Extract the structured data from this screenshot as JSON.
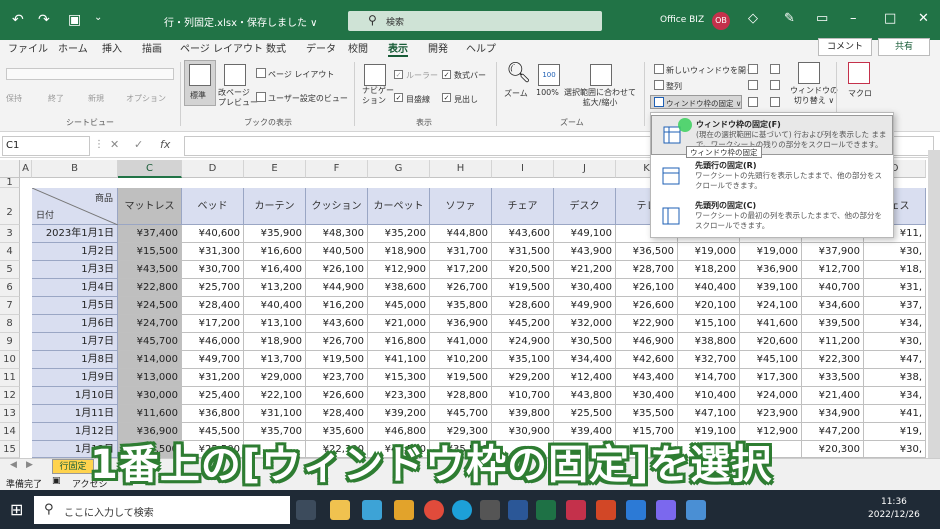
{
  "titlebar": {
    "filename": "行・列固定.xlsx・保存しました ∨",
    "search_icon": "search-icon",
    "search_placeholder": "検索",
    "account": "Office BIZ",
    "avatar": "OB"
  },
  "tabs": [
    "ファイル",
    "ホーム",
    "挿入",
    "描画",
    "ページ レイアウト",
    "数式",
    "データ",
    "校閲",
    "表示",
    "開発",
    "ヘルプ"
  ],
  "active_tab": "表示",
  "comment_btn": "コメント",
  "share_btn": "共有",
  "ribbon": {
    "sheetview": {
      "buttons": [
        "保持",
        "終了",
        "新規",
        "オプション"
      ],
      "label": "シートビュー"
    },
    "bookview": {
      "normal": "標準",
      "pagebreak": "改ページ\nプレビュー",
      "pagelayout": "ページ レイアウト",
      "userview": "ユーザー設定のビュー",
      "label": "ブックの表示"
    },
    "show": {
      "nav": "ナビゲー\nション",
      "ruler": "ルーラー",
      "formulabar": "数式バー",
      "gridlines": "目盛線",
      "headings": "見出し",
      "label": "表示"
    },
    "zoom": {
      "zoom": "ズーム",
      "z100": "100%",
      "tosel": "選択範囲に合わせて\n拡大/縮小",
      "label": "ズーム"
    },
    "window": {
      "newwin": "新しいウィンドウを開く",
      "arrange": "整列",
      "freeze": "ウィンドウ枠の固定 ∨",
      "switch": "ウィンドウの\n切り替え ∨"
    },
    "macro": {
      "label": "マクロ"
    }
  },
  "formulabar": {
    "namebox": "C1"
  },
  "columns": [
    "A",
    "B",
    "C",
    "D",
    "E",
    "F",
    "G",
    "H",
    "I",
    "J",
    "K",
    "L",
    "M",
    "N",
    "O"
  ],
  "rows": [
    "1",
    "2",
    "3",
    "4",
    "5",
    "6",
    "7",
    "8",
    "9",
    "10",
    "11",
    "12",
    "13",
    "14",
    "15"
  ],
  "header": {
    "corner_top": "商品",
    "corner_bottom": "日付",
    "products": [
      "マットレス",
      "ベッド",
      "カーテン",
      "クッション",
      "カーペット",
      "ソファ",
      "チェア",
      "デスク",
      "テレ",
      "",
      "",
      "",
      "チェス"
    ]
  },
  "data": [
    {
      "date": "2023年1月1日",
      "vals": [
        "¥37,400",
        "¥40,600",
        "¥35,900",
        "¥48,300",
        "¥35,200",
        "¥44,800",
        "¥43,600",
        "¥49,100",
        "",
        "",
        "",
        "",
        "¥11,"
      ]
    },
    {
      "date": "1月2日",
      "vals": [
        "¥15,500",
        "¥31,300",
        "¥16,600",
        "¥40,500",
        "¥18,900",
        "¥31,700",
        "¥31,500",
        "¥43,900",
        "¥36,500",
        "¥19,000",
        "¥19,000",
        "¥37,900",
        "¥30,"
      ]
    },
    {
      "date": "1月3日",
      "vals": [
        "¥43,500",
        "¥30,700",
        "¥16,400",
        "¥26,100",
        "¥12,900",
        "¥17,200",
        "¥20,500",
        "¥21,200",
        "¥28,700",
        "¥18,200",
        "¥36,900",
        "¥12,700",
        "¥18,"
      ]
    },
    {
      "date": "1月4日",
      "vals": [
        "¥22,800",
        "¥25,700",
        "¥13,200",
        "¥44,900",
        "¥38,600",
        "¥26,700",
        "¥19,500",
        "¥30,400",
        "¥26,100",
        "¥40,400",
        "¥39,100",
        "¥40,700",
        "¥31,"
      ]
    },
    {
      "date": "1月5日",
      "vals": [
        "¥24,500",
        "¥28,400",
        "¥40,400",
        "¥16,200",
        "¥45,000",
        "¥35,800",
        "¥28,600",
        "¥49,900",
        "¥26,600",
        "¥20,100",
        "¥24,100",
        "¥34,600",
        "¥37,"
      ]
    },
    {
      "date": "1月6日",
      "vals": [
        "¥24,700",
        "¥17,200",
        "¥13,100",
        "¥43,600",
        "¥21,000",
        "¥36,900",
        "¥45,200",
        "¥32,000",
        "¥22,900",
        "¥15,100",
        "¥41,600",
        "¥39,500",
        "¥34,"
      ]
    },
    {
      "date": "1月7日",
      "vals": [
        "¥45,700",
        "¥46,000",
        "¥18,900",
        "¥26,700",
        "¥16,800",
        "¥41,000",
        "¥24,900",
        "¥30,500",
        "¥46,900",
        "¥38,800",
        "¥20,600",
        "¥11,200",
        "¥30,"
      ]
    },
    {
      "date": "1月8日",
      "vals": [
        "¥14,000",
        "¥49,700",
        "¥13,700",
        "¥19,500",
        "¥41,100",
        "¥10,200",
        "¥35,100",
        "¥34,400",
        "¥42,600",
        "¥32,700",
        "¥45,100",
        "¥22,300",
        "¥47,"
      ]
    },
    {
      "date": "1月9日",
      "vals": [
        "¥13,000",
        "¥31,200",
        "¥29,000",
        "¥23,700",
        "¥15,300",
        "¥19,500",
        "¥29,200",
        "¥12,400",
        "¥43,400",
        "¥14,700",
        "¥17,300",
        "¥33,500",
        "¥38,"
      ]
    },
    {
      "date": "1月10日",
      "vals": [
        "¥30,000",
        "¥25,400",
        "¥22,100",
        "¥26,600",
        "¥23,300",
        "¥28,800",
        "¥10,700",
        "¥43,800",
        "¥30,400",
        "¥10,400",
        "¥24,000",
        "¥21,400",
        "¥34,"
      ]
    },
    {
      "date": "1月11日",
      "vals": [
        "¥11,600",
        "¥36,800",
        "¥31,100",
        "¥28,400",
        "¥39,200",
        "¥45,700",
        "¥39,800",
        "¥25,500",
        "¥35,500",
        "¥47,100",
        "¥23,900",
        "¥34,900",
        "¥41,"
      ]
    },
    {
      "date": "1月12日",
      "vals": [
        "¥36,900",
        "¥45,500",
        "¥35,700",
        "¥35,600",
        "¥46,800",
        "¥29,300",
        "¥30,900",
        "¥39,400",
        "¥15,700",
        "¥19,100",
        "¥12,900",
        "¥47,200",
        "¥19,"
      ]
    },
    {
      "date": "1月13日",
      "vals": [
        "¥25,500",
        "¥25,500",
        "",
        "¥22,300",
        "¥47,500",
        "¥35,500",
        "",
        "",
        "",
        "",
        "",
        "¥20,300",
        "¥30,"
      ]
    }
  ],
  "dropdown": [
    {
      "title": "ウィンドウ枠の固定(F)",
      "desc": "(現在の選択範囲に基づいて) 行および列を表示した ままで、ワークシートの残りの部分をスクロールできます。"
    },
    {
      "title": "先頭行の固定(R)",
      "desc": "ワークシートの先頭行を表示したままで、他の部分をス クロールできます。"
    },
    {
      "title": "先頭列の固定(C)",
      "desc": "ワークシートの最初の列を表示したままで、他の部分を スクロールできます。"
    }
  ],
  "tooltip": "ウィンドウ枠の固定",
  "sheet_tab": "行固定",
  "statusbar": {
    "ready": "準備完了",
    "accessibility": "アクセシ"
  },
  "caption": "1番上の[ウィンドウ枠の固定]を選択",
  "taskbar": {
    "search": "ここに入力して検索",
    "time": "11:36",
    "date": "2022/12/26"
  }
}
